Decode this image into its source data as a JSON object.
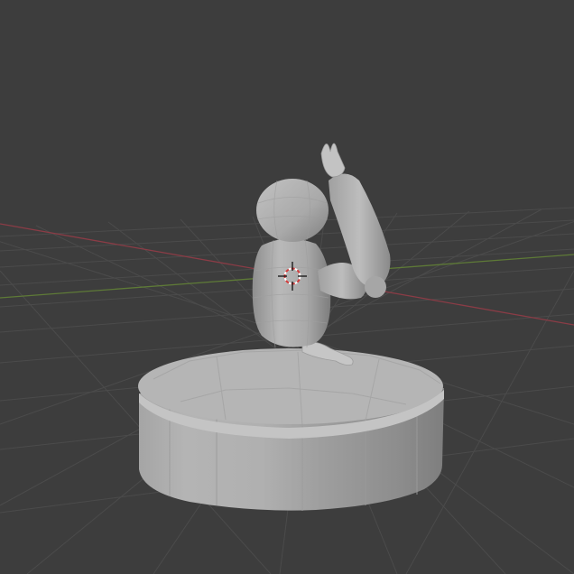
{
  "viewport": {
    "mode": "3d-viewport-solid-shading",
    "background_color": "#3d3d3d",
    "grid_color": "#4a4a4a",
    "x_axis_color": "#8a3c46",
    "y_axis_color": "#5e7a37",
    "mesh_color": "#b8b8b8"
  },
  "scene": {
    "objects": [
      {
        "name": "base-cylinder"
      },
      {
        "name": "character-body"
      },
      {
        "name": "character-head"
      },
      {
        "name": "raised-arm"
      },
      {
        "name": "hand-on-base"
      }
    ],
    "cursor_icon": "3d-cursor-icon"
  }
}
